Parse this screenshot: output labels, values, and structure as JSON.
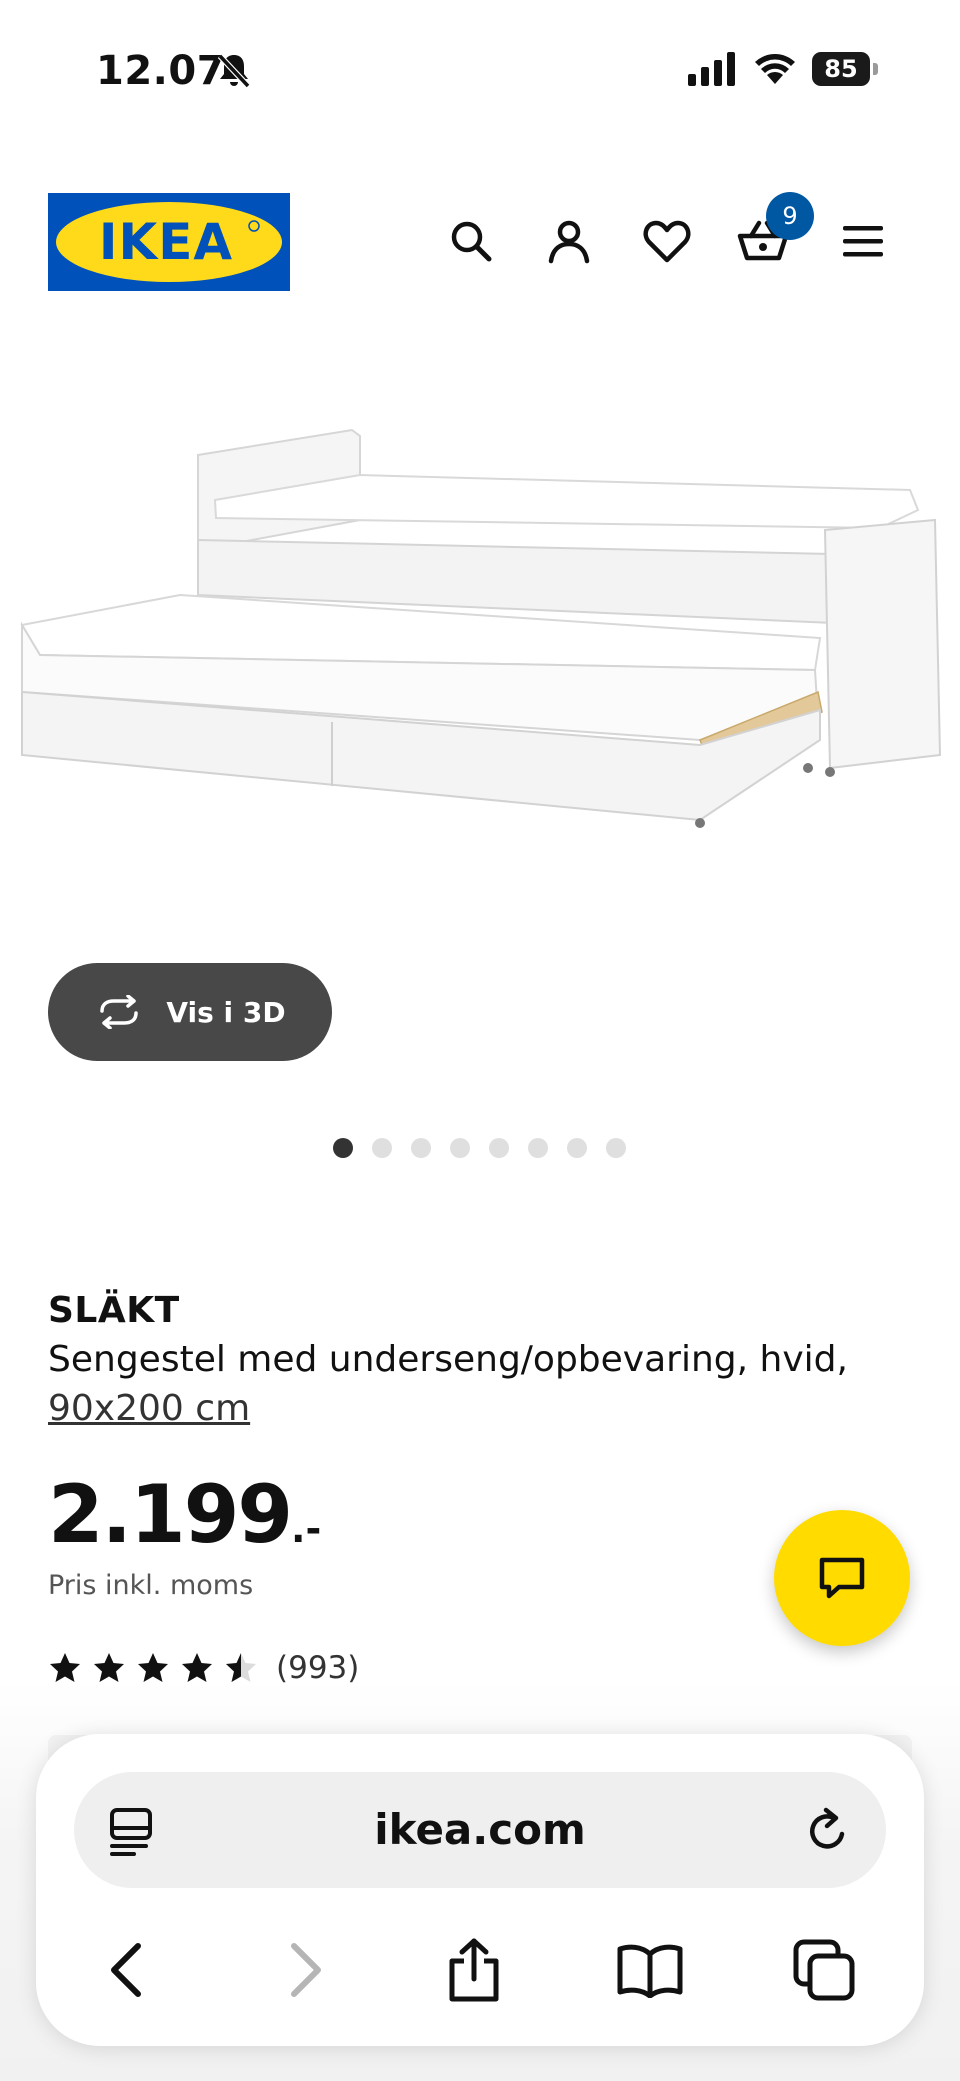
{
  "status_bar": {
    "time": "12.07",
    "battery_percent": "85",
    "battery_level": 0.85
  },
  "header": {
    "logo_text": "IKEA",
    "cart_count": "9",
    "icons": [
      "search-icon",
      "account-icon",
      "heart-icon",
      "cart-icon",
      "menu-icon"
    ]
  },
  "gallery": {
    "view_3d_label": "Vis i 3D",
    "image_count": 8,
    "active_index": 0
  },
  "product": {
    "name": "SLÄKT",
    "description": "Sengestel med underseng/opbevaring, hvid,",
    "size": "90x200 cm",
    "price_main": "2.199",
    "price_suffix": ".-",
    "price_note": "Pris inkl. moms",
    "rating_value": 4.5,
    "rating_max": 5,
    "review_count": "(993)"
  },
  "browser": {
    "url": "ikea.com"
  },
  "colors": {
    "ikea_blue": "#0051ba",
    "ikea_yellow": "#ffda1a",
    "badge_blue": "#0058a3",
    "chat_yellow": "#ffdb00",
    "button_dark": "#484848"
  }
}
